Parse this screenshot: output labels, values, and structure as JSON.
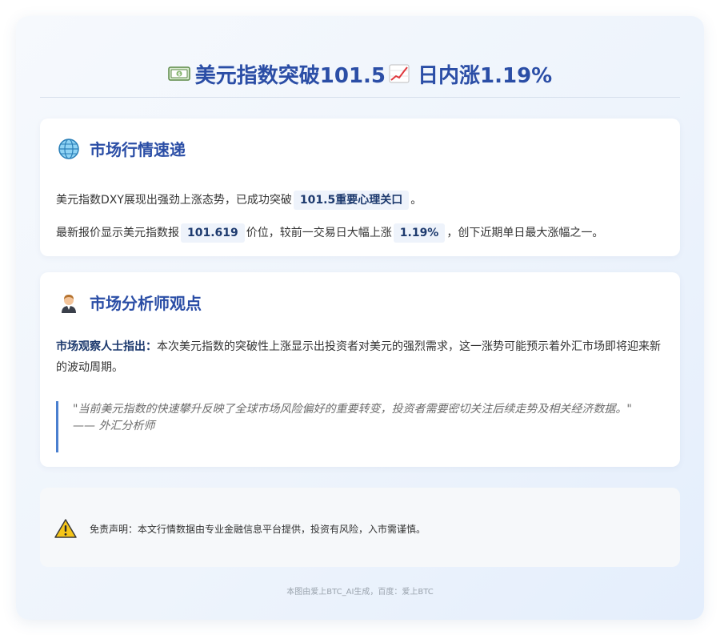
{
  "header": {
    "title_part1": "美元指数突破101.5",
    "title_part2": "日内涨1.19%",
    "icon_left": "banknote-icon",
    "icon_right": "chart-increasing-icon"
  },
  "market_section": {
    "icon": "globe-icon",
    "heading": "市场行情速递",
    "p1_before": "美元指数DXY展现出强劲上涨态势，已成功突破",
    "p1_highlight": "101.5重要心理关口",
    "p1_after": "。",
    "p2_before": "最新报价显示美元指数报",
    "p2_highlight1": "101.619",
    "p2_middle": "价位，较前一交易日大幅上涨",
    "p2_highlight2": "1.19%",
    "p2_after": "，创下近期单日最大涨幅之一。"
  },
  "analyst_section": {
    "icon": "office-worker-icon",
    "heading": "市场分析师观点",
    "lead_label": "市场观察人士指出：",
    "lead_text": "本次美元指数的突破性上涨显示出投资者对美元的强烈需求，这一涨势可能预示着外汇市场即将迎来新的波动周期。",
    "quote_text": "\"当前美元指数的快速攀升反映了全球市场风险偏好的重要转变，投资者需要密切关注后续走势及相关经济数据。\"",
    "quote_source": "—— 外汇分析师"
  },
  "disclaimer": {
    "icon": "warning-icon",
    "text": "免责声明：本文行情数据由专业金融信息平台提供，投资有风险，入市需谨慎。"
  },
  "footer": {
    "text": "本图由爱上BTC_AI生成，百度：爱上BTC"
  },
  "colors": {
    "accent": "#2b4ea6",
    "highlight_bg": "#eef3fb",
    "quote_border": "#4a7fcf",
    "warning": "#f5c518"
  }
}
